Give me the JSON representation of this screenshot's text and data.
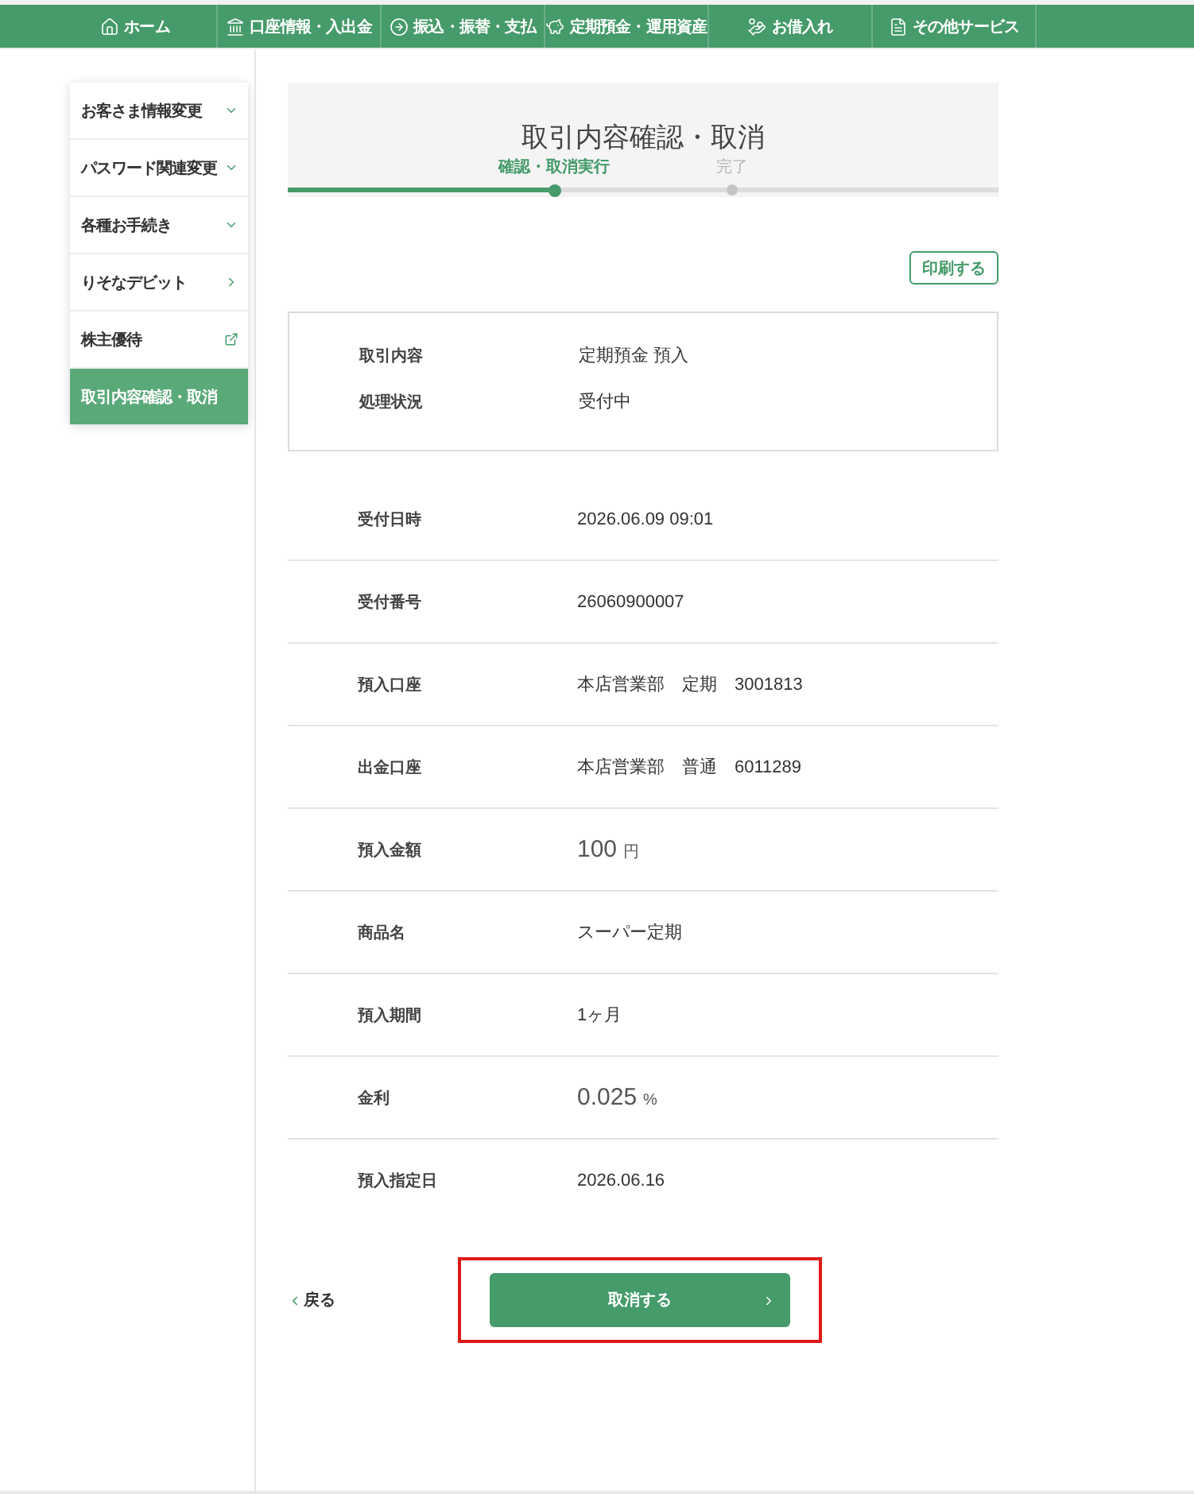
{
  "nav": {
    "items": [
      {
        "label": "ホーム"
      },
      {
        "label": "口座情報・入出金"
      },
      {
        "label": "振込・振替・支払"
      },
      {
        "label": "定期預金・運用資産"
      },
      {
        "label": "お借入れ"
      },
      {
        "label": "その他サービス"
      }
    ]
  },
  "sidebar": {
    "items": [
      {
        "label": "お客さま情報変更",
        "kind": "expand",
        "selected": false
      },
      {
        "label": "パスワード関連変更",
        "kind": "expand",
        "selected": false
      },
      {
        "label": "各種お手続き",
        "kind": "expand",
        "selected": false
      },
      {
        "label": "りそなデビット",
        "kind": "link",
        "selected": false
      },
      {
        "label": "株主優待",
        "kind": "external",
        "selected": false
      },
      {
        "label": "取引内容確認・取消",
        "kind": "page",
        "selected": true
      }
    ]
  },
  "page": {
    "title": "取引内容確認・取消",
    "steps": [
      {
        "label": "確認・取消実行",
        "selected": true
      },
      {
        "label": "完了",
        "selected": false
      }
    ],
    "print_button": "印刷する",
    "summary": [
      {
        "label": "取引内容",
        "value": "定期預金 預入"
      },
      {
        "label": "処理状況",
        "value": "受付中"
      }
    ],
    "details": [
      {
        "kind": "text",
        "label": "受付日時",
        "value": "2026.06.09 09:01"
      },
      {
        "kind": "text",
        "label": "受付番号",
        "value": "26060900007"
      },
      {
        "kind": "text",
        "label": "預入口座",
        "value": "本店営業部　定期　3001813"
      },
      {
        "kind": "text",
        "label": "出金口座",
        "value": "本店営業部　普通　6011289"
      },
      {
        "kind": "amount",
        "label": "預入金額",
        "value": "100",
        "unit": "円"
      },
      {
        "kind": "text",
        "label": "商品名",
        "value": "スーパー定期"
      },
      {
        "kind": "text",
        "label": "預入期間",
        "value": "1ヶ月"
      },
      {
        "kind": "amount",
        "label": "金利",
        "value": "0.025",
        "unit": "%"
      },
      {
        "kind": "text",
        "label": "預入指定日",
        "value": "2026.06.16"
      }
    ],
    "back_link": "戻る",
    "submit": {
      "label": "取消する",
      "highlighted": true
    }
  }
}
